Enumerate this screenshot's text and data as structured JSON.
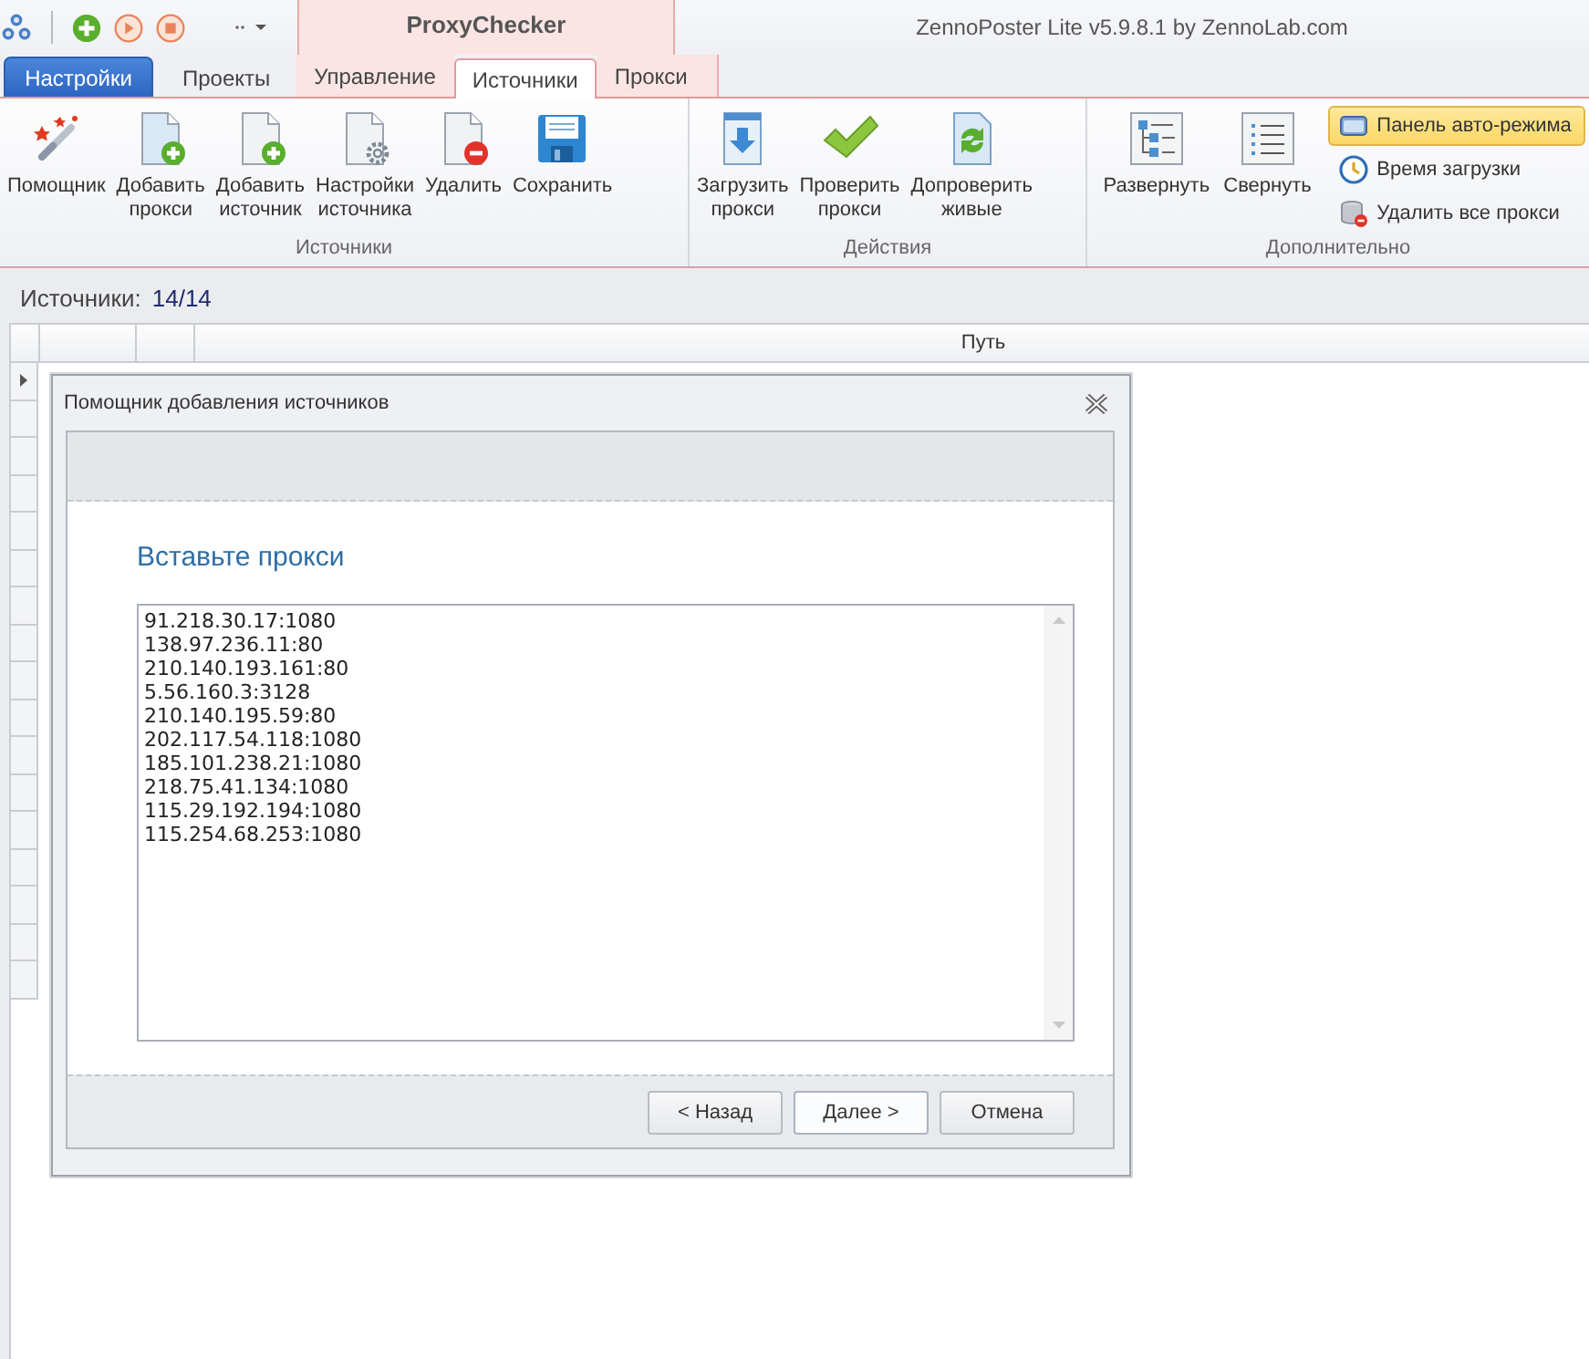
{
  "window": {
    "title": "ZennoPoster Lite v5.9.8.1 by ZennoLab.com"
  },
  "context_tab_group": {
    "title": "ProxyChecker"
  },
  "app_menu_button": "Настройки",
  "tabs": [
    {
      "label": "Проекты",
      "selected": false,
      "contextual": false
    },
    {
      "label": "Управление",
      "selected": false,
      "contextual": true
    },
    {
      "label": "Источники",
      "selected": true,
      "contextual": true
    },
    {
      "label": "Прокси",
      "selected": false,
      "contextual": true
    }
  ],
  "ribbon_groups": [
    {
      "title": "Источники",
      "items": [
        {
          "kind": "large",
          "label": "Помощник"
        },
        {
          "kind": "large",
          "label": "Добавить\nпрокси"
        },
        {
          "kind": "large",
          "label": "Добавить\nисточник"
        },
        {
          "kind": "large",
          "label": "Настройки\nисточника"
        },
        {
          "kind": "large",
          "label": "Удалить"
        },
        {
          "kind": "large",
          "label": "Сохранить"
        }
      ]
    },
    {
      "title": "Действия",
      "items": [
        {
          "kind": "large",
          "label": "Загрузить\nпрокси"
        },
        {
          "kind": "large",
          "label": "Проверить\nпрокси"
        },
        {
          "kind": "large",
          "label": "Допроверить\nживые"
        }
      ]
    },
    {
      "title": "Дополнительно",
      "items": [
        {
          "kind": "large",
          "label": "Развернуть"
        },
        {
          "kind": "large",
          "label": "Свернуть"
        },
        {
          "kind": "small",
          "label": "Панель авто-режима",
          "checked": true
        },
        {
          "kind": "small",
          "label": "Время загрузки",
          "checked": false
        },
        {
          "kind": "small",
          "label": "Удалить все прокси",
          "checked": false
        }
      ]
    }
  ],
  "sources_bar": {
    "label": "Источники:",
    "count": "14/14"
  },
  "grid": {
    "path_header": "Путь"
  },
  "dialog": {
    "title": "Помощник добавления источников",
    "heading": "Вставьте прокси",
    "proxy_list": {
      "value": "91.218.30.17:1080\n138.97.236.11:80\n210.140.193.161:80\n5.56.160.3:3128\n210.140.195.59:80\n202.117.54.118:1080\n185.101.238.21:1080\n218.75.41.134:1080\n115.29.192.194:1080\n115.254.68.253:1080"
    },
    "buttons": [
      {
        "label": "< Назад",
        "default": false
      },
      {
        "label": "Далее >",
        "default": true
      },
      {
        "label": "Отмена",
        "default": false
      }
    ]
  }
}
